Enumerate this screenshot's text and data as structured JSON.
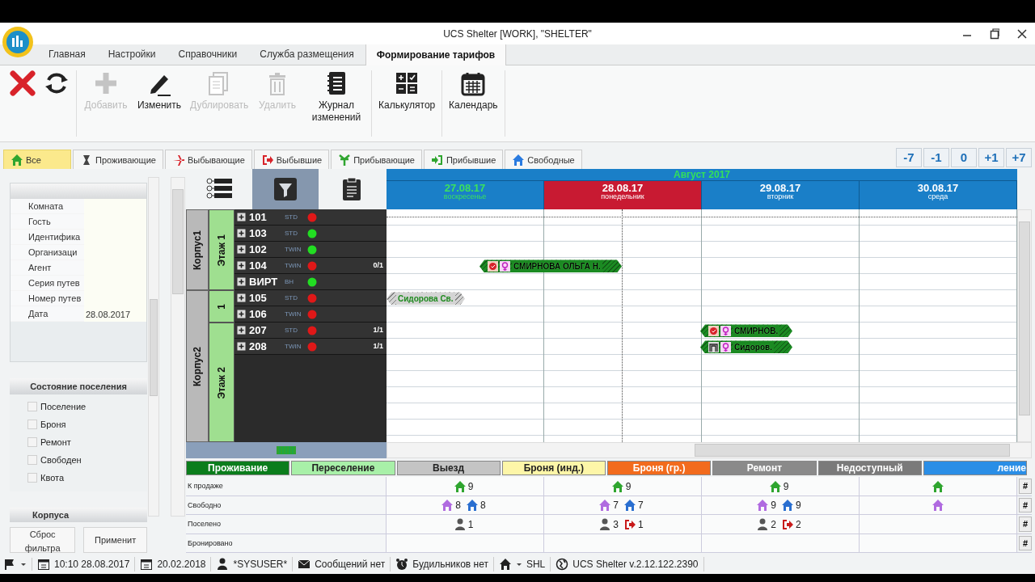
{
  "window": {
    "title": "UCS Shelter [WORK], \"SHELTER\""
  },
  "ribbon_tabs": [
    {
      "label": "Главная",
      "selected": false
    },
    {
      "label": "Настройки",
      "selected": false
    },
    {
      "label": "Справочники",
      "selected": false
    },
    {
      "label": "Служба размещения",
      "selected": false
    },
    {
      "label": "Формирование тарифов",
      "selected": true
    }
  ],
  "toolbar_groups": [
    [
      {
        "kind": "close"
      },
      {
        "kind": "refresh"
      }
    ],
    [
      {
        "kind": "add",
        "label": "Добавить",
        "disabled": true
      },
      {
        "kind": "edit",
        "label": "Изменить",
        "disabled": false
      },
      {
        "kind": "duplicate",
        "label": "Дублировать",
        "disabled": true
      },
      {
        "kind": "delete",
        "label": "Удалить",
        "disabled": true
      },
      {
        "kind": "journal",
        "label": "Журнал изменений",
        "disabled": false
      }
    ],
    [
      {
        "kind": "calculator",
        "label": "Калькулятор",
        "disabled": false
      }
    ],
    [
      {
        "kind": "calendar",
        "label": "Календарь",
        "disabled": false
      }
    ]
  ],
  "filter_tabs": [
    {
      "kind": "all",
      "label": "Все",
      "selected": true
    },
    {
      "kind": "living",
      "label": "Проживающие",
      "selected": false
    },
    {
      "kind": "departing",
      "label": "Выбывающие",
      "selected": false
    },
    {
      "kind": "departed",
      "label": "Выбывшие",
      "selected": false
    },
    {
      "kind": "arriving",
      "label": "Прибывающие",
      "selected": false
    },
    {
      "kind": "arrived",
      "label": "Прибывшие",
      "selected": false
    },
    {
      "kind": "free",
      "label": "Свободные",
      "selected": false
    }
  ],
  "day_nav": [
    "-7",
    "-1",
    "0",
    "+1",
    "+7"
  ],
  "left_panel": {
    "fields": [
      {
        "label": "Комната"
      },
      {
        "label": "Гость"
      },
      {
        "label": "Идентифика"
      },
      {
        "label": "Организаци"
      },
      {
        "label": "Агент"
      },
      {
        "label": "Серия путев"
      },
      {
        "label": "Номер путев"
      },
      {
        "label": "Дата",
        "value": "28.08.2017"
      }
    ],
    "status_title": "Состояние поселения",
    "statuses": [
      {
        "label": "Поселение",
        "checked": false
      },
      {
        "label": "Броня",
        "checked": false
      },
      {
        "label": "Ремонт",
        "checked": false
      },
      {
        "label": "Свободен",
        "checked": false
      },
      {
        "label": "Квота",
        "checked": false
      }
    ],
    "buildings_title": "Корпуса",
    "buttons": [
      "Сброс фильтра",
      "Применит"
    ]
  },
  "view_buttons": [
    {
      "kind": "tree",
      "selected": false
    },
    {
      "kind": "filter",
      "selected": true
    },
    {
      "kind": "list",
      "selected": false
    }
  ],
  "calendar": {
    "month": "Август 2017",
    "days": [
      {
        "date": "27.08.17",
        "weekday": "воскресенье",
        "selected": false,
        "weekend": true
      },
      {
        "date": "28.08.17",
        "weekday": "понедельник",
        "selected": true,
        "weekend": false
      },
      {
        "date": "29.08.17",
        "weekday": "вторник",
        "selected": false,
        "weekend": false
      },
      {
        "date": "30.08.17",
        "weekday": "среда",
        "selected": false,
        "weekend": false
      }
    ]
  },
  "tree": [
    {
      "name": "Корпус1",
      "floors": [
        {
          "name": "Этаж 1",
          "rooms": [
            {
              "number": "101",
              "type": "STD",
              "color": "#e01818"
            },
            {
              "number": "103",
              "type": "STD",
              "color": "#22dd22"
            },
            {
              "number": "102",
              "type": "TWIN",
              "color": "#22dd22"
            },
            {
              "number": "104",
              "type": "TWIN",
              "color": "#e01818",
              "count": "0/1",
              "bookings": [
                {
                  "kind": "stay",
                  "guest": "СМИРНОВА ОЛЬГА Н.",
                  "checked_in": true,
                  "female": true
                }
              ]
            },
            {
              "number": "ВИРТ",
              "type": "BH",
              "color": "#22dd22"
            }
          ]
        }
      ]
    },
    {
      "name": "Корпус2",
      "floors": [
        {
          "name": "1",
          "rooms": [
            {
              "number": "105",
              "type": "STD",
              "color": "#e01818",
              "bookings": [
                {
                  "kind": "departed",
                  "guest": "Сидорова Св."
                }
              ]
            },
            {
              "number": "106",
              "type": "TWIN",
              "color": "#e01818"
            }
          ]
        },
        {
          "name": "Этаж 2",
          "rooms": [
            {
              "number": "207",
              "type": "STD",
              "color": "#e01818",
              "count": "1/1",
              "bookings": [
                {
                  "kind": "stay",
                  "guest": "СМИРНОВ.",
                  "checked_in": true,
                  "female": true
                }
              ]
            },
            {
              "number": "208",
              "type": "TWIN",
              "color": "#e01818",
              "count": "1/1",
              "bookings": [
                {
                  "kind": "stay",
                  "guest": "Сидоров.",
                  "checked_in": false,
                  "female": true
                }
              ]
            }
          ]
        }
      ]
    }
  ],
  "legend": [
    {
      "label": "Проживание",
      "color": "#0b7d1c"
    },
    {
      "label": "Переселение",
      "color": "#a8f0a8"
    },
    {
      "label": "Выезд",
      "color": "#c4c4c4"
    },
    {
      "label": "Броня (инд.)",
      "color": "#fdf6a8"
    },
    {
      "label": "Броня (гр.)",
      "color": "#f26b1d"
    },
    {
      "label": "Ремонт",
      "color": "#8a8a8a"
    },
    {
      "label": "Недоступный",
      "color": "#7a7a7a"
    },
    {
      "label": "ление",
      "color": "#2a8ee6"
    }
  ],
  "stats": [
    {
      "label": "К продаже",
      "button": "#",
      "days": [
        [
          {
            "kind": "house-green",
            "count": "9"
          }
        ],
        [
          {
            "kind": "house-green",
            "count": "9"
          }
        ],
        [
          {
            "kind": "house-green",
            "count": "9"
          }
        ],
        [
          {
            "kind": "house-green"
          }
        ]
      ]
    },
    {
      "label": "Свободно",
      "button": "#",
      "days": [
        [
          {
            "kind": "house-purple",
            "count": "8"
          },
          {
            "kind": "house-blue",
            "count": "8"
          }
        ],
        [
          {
            "kind": "house-purple",
            "count": "7"
          },
          {
            "kind": "house-blue",
            "count": "7"
          }
        ],
        [
          {
            "kind": "house-purple",
            "count": "9"
          },
          {
            "kind": "house-blue",
            "count": "9"
          }
        ],
        [
          {
            "kind": "house-purple"
          }
        ]
      ]
    },
    {
      "label": "Поселено",
      "button": "#",
      "days": [
        [
          {
            "kind": "person",
            "count": "1"
          }
        ],
        [
          {
            "kind": "person",
            "count": "3"
          },
          {
            "kind": "exit",
            "count": "1"
          }
        ],
        [
          {
            "kind": "person",
            "count": "2"
          },
          {
            "kind": "exit",
            "count": "2"
          }
        ]
      ]
    },
    {
      "label": "Бронировано",
      "button": "#"
    }
  ],
  "status_bar": [
    {
      "kind": "flag"
    },
    {
      "kind": "calendar",
      "text": "10:10 28.08.2017"
    },
    {
      "kind": "calendar",
      "text": "20.02.2018"
    },
    {
      "kind": "user",
      "text": "*SYSUSER*"
    },
    {
      "kind": "mail",
      "text": "Сообщений нет"
    },
    {
      "kind": "alarm",
      "text": "Будильников нет"
    },
    {
      "kind": "home",
      "text": "SHL"
    },
    {
      "kind": "globe",
      "text": "UCS Shelter v.2.12.122.2390"
    }
  ]
}
